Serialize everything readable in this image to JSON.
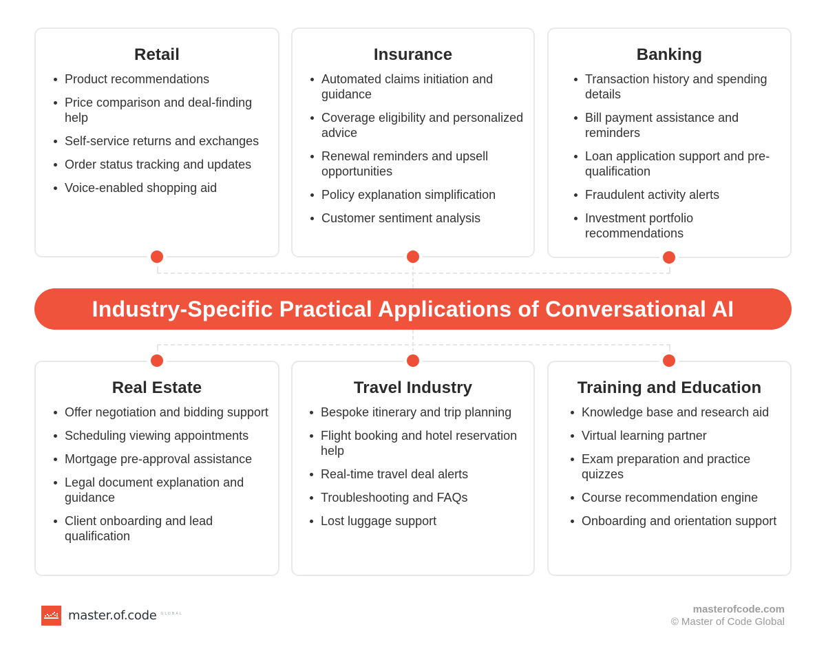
{
  "title": "Industry-Specific Practical Applications of Conversational AI",
  "colors": {
    "accent": "#ef533b",
    "card_border": "#e9e9e9",
    "text": "#333333",
    "footer_text": "#9a9a9a"
  },
  "top_cards": [
    {
      "title": "Retail",
      "items": [
        "Product recommendations",
        "Price comparison and deal-finding help",
        "Self-service returns and exchanges",
        "Order status tracking and updates",
        "Voice-enabled shopping aid"
      ]
    },
    {
      "title": "Insurance",
      "items": [
        "Automated claims initiation and guidance",
        "Coverage eligibility and personalized advice",
        "Renewal reminders and upsell opportunities",
        "Policy explanation simplification",
        "Customer sentiment analysis"
      ]
    },
    {
      "title": "Banking",
      "items": [
        "Transaction history and spending details",
        "Bill payment assistance and reminders",
        "Loan application support and pre-qualification",
        "Fraudulent activity alerts",
        "Investment portfolio recommendations"
      ]
    }
  ],
  "bottom_cards": [
    {
      "title": "Real Estate",
      "items": [
        "Offer negotiation and bidding support",
        "Scheduling viewing appointments",
        "Mortgage pre-approval assistance",
        "Legal document explanation and guidance",
        "Client onboarding and lead qualification"
      ]
    },
    {
      "title": "Travel Industry",
      "items": [
        "Bespoke itinerary and trip planning",
        "Flight booking and hotel reservation help",
        "Real-time travel deal alerts",
        "Troubleshooting and FAQs",
        "Lost luggage support"
      ]
    },
    {
      "title": "Training and Education",
      "items": [
        "Knowledge base and research aid",
        "Virtual learning partner",
        "Exam preparation and practice quizzes",
        "Course recommendation engine",
        "Onboarding and orientation support"
      ]
    }
  ],
  "footer": {
    "logo_text": "master.of.code",
    "logo_sub": "GLOBAL",
    "logo_icon": "master-of-code-logo-icon",
    "site": "masterofcode.com",
    "copyright": "© Master of Code Global"
  }
}
